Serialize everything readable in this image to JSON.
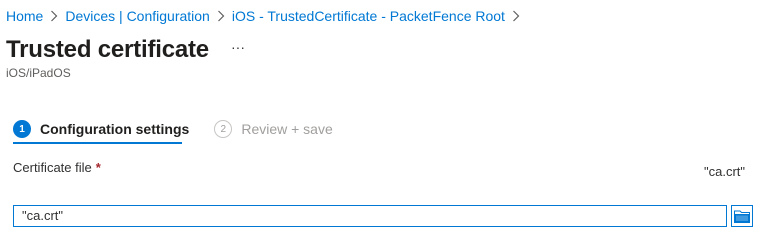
{
  "breadcrumb": {
    "items": [
      "Home",
      "Devices | Configuration",
      "iOS - TrustedCertificate - PacketFence Root"
    ]
  },
  "header": {
    "title": "Trusted certificate",
    "more": "···",
    "subtitle": "iOS/iPadOS"
  },
  "wizard": {
    "steps": [
      {
        "number": "1",
        "label": "Configuration settings",
        "state": "active"
      },
      {
        "number": "2",
        "label": "Review + save",
        "state": "inactive"
      }
    ]
  },
  "form": {
    "certificate_label": "Certificate file",
    "required_marker": "*",
    "certificate_value_display": "\"ca.crt\"",
    "file_input_value": "\"ca.crt\"",
    "browse_icon": "folder-icon"
  },
  "colors": {
    "accent": "#0078d4",
    "required": "#a4262c"
  }
}
